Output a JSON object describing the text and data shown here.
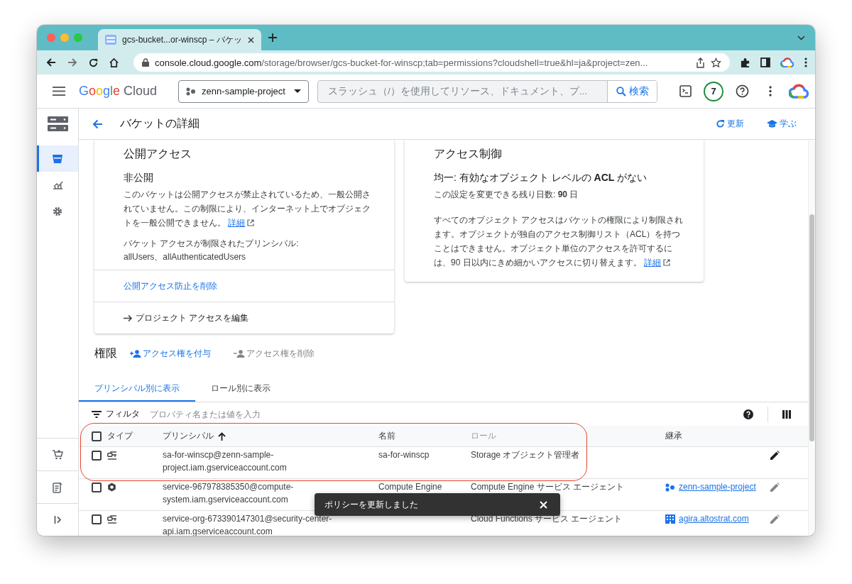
{
  "browser": {
    "tabs": [
      {
        "title": "gcs-bucket...or-winscp – バケッ",
        "selected": true
      }
    ],
    "url_host": "console.cloud.google.com",
    "url_path": "/storage/browser/gcs-bucket-for-winscp;tab=permissions?cloudshell=true&hl=ja&project=zen..."
  },
  "header": {
    "logo_brand": "Google",
    "logo_product": "Cloud",
    "project": "zenn-sample-project",
    "search_placeholder": "スラッシュ（/）を使用してリソース、ドキュメント、プ...",
    "search_button": "検索",
    "badge": "7"
  },
  "sidebar": {
    "items": [
      {
        "kind": "bucket",
        "selected": true
      },
      {
        "kind": "chart",
        "selected": false
      },
      {
        "kind": "settings",
        "selected": false
      }
    ],
    "footer": [
      {
        "kind": "cart"
      },
      {
        "kind": "notes"
      },
      {
        "kind": "expand"
      }
    ]
  },
  "page": {
    "title": "バケットの詳細",
    "actions": [
      {
        "kind": "refresh",
        "label": "更新"
      },
      {
        "kind": "learn",
        "label": "学ぶ"
      }
    ]
  },
  "public_access_card": {
    "title": "公開アクセス",
    "status": "非公開",
    "description": "このバケットは公開アクセスが禁止されているため、一般公開されていません。この制限により、インターネット上でオブジェクトを一般公開できません。",
    "learn_more": "詳細",
    "principals_label": "バケット アクセスが制限されたプリンシパル:",
    "principals": "allUsers、allAuthenticatedUsers",
    "actions": [
      {
        "kind": "link",
        "label": "公開アクセス防止を削除"
      },
      {
        "kind": "arrow",
        "label": "プロジェクト アクセスを編集"
      }
    ]
  },
  "access_control_card": {
    "title": "アクセス制御",
    "status": "均一: 有効なオブジェクト レベルの **ACL** がない",
    "days_remaining": "この設定を変更できる残り日数: **90** 日",
    "description": "すべてのオブジェクト アクセスはバケットの権限により制限されます。オブジェクトが独自のアクセス制御リスト（ACL）を持つことはできません。オブジェクト単位のアクセスを許可するには、90 日以内にきめ細かいアクセスに切り替えます。",
    "learn_more": "詳細"
  },
  "permissions": {
    "title": "権限",
    "actions": [
      {
        "kind": "grant",
        "label": "アクセス権を付与",
        "disabled": false
      },
      {
        "kind": "remove",
        "label": "アクセス権を削除",
        "disabled": true
      }
    ]
  },
  "view_tabs": [
    {
      "label": "プリンシパル別に表示",
      "selected": true
    },
    {
      "label": "ロール別に表示",
      "selected": false
    }
  ],
  "filter": {
    "label": "フィルタ",
    "placeholder": "プロパティ名または値を入力"
  },
  "table": {
    "select_all": false,
    "columns": [
      {
        "label": "タイプ",
        "sorted": false,
        "muted": false
      },
      {
        "label": "プリンシパル",
        "sorted": true,
        "muted": false
      },
      {
        "label": "名前",
        "sorted": false,
        "muted": false
      },
      {
        "label": "ロール",
        "sorted": false,
        "muted": true
      },
      {
        "label": "継承",
        "sorted": false,
        "muted": false
      }
    ],
    "rows": [
      {
        "checked": false,
        "kind": "service-account",
        "principal": "sa-for-winscp@zenn-sample-project.iam.gserviceaccount.com",
        "name": "sa-for-winscp",
        "role": "Storage オブジェクト管理者",
        "highlighted": true
      },
      {
        "checked": false,
        "kind": "service-agent",
        "principal": "service-967978385350@compute-system.iam.gserviceaccount.com",
        "name": "Compute Engine",
        "role": "Compute Engine サービス エージェント",
        "inherited": {
          "kind": "project",
          "label": "zenn-sample-project"
        },
        "highlighted": false
      },
      {
        "checked": false,
        "kind": "service-account",
        "principal": "service-org-673390147301@security-center-api.iam.gserviceaccount.com",
        "role": "Cloud Functions サービス エージェント",
        "inherited": {
          "kind": "organization",
          "label": "agira.altostrat.com"
        },
        "highlighted": false
      }
    ]
  },
  "toast": {
    "message": "ポリシーを更新しました"
  }
}
